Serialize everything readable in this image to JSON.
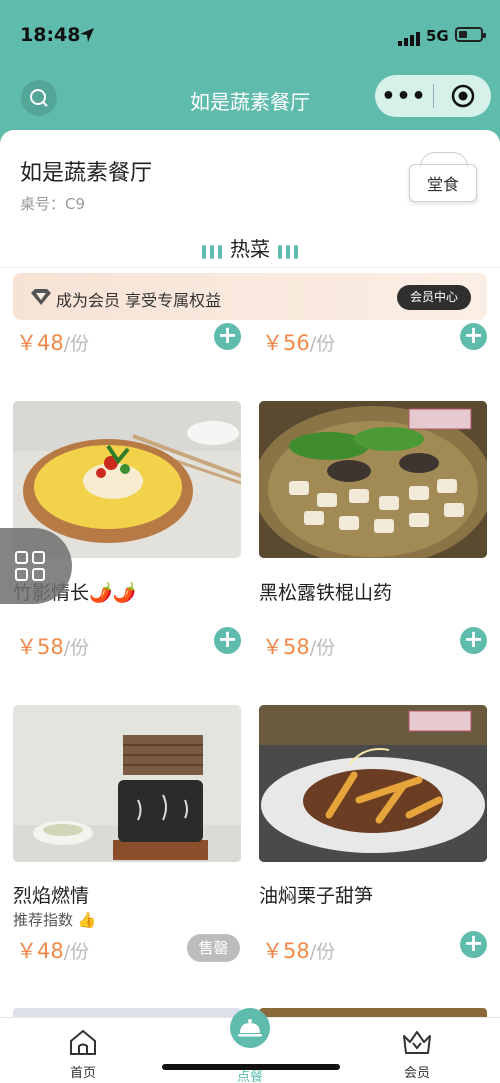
{
  "status": {
    "time": "18:48",
    "network": "5G"
  },
  "nav": {
    "title": "如是蔬素餐厅"
  },
  "header": {
    "restaurant_name": "如是蔬素餐厅",
    "table_no": "桌号：C9",
    "dine_mode": "堂食"
  },
  "category": {
    "title": "热菜"
  },
  "member": {
    "text": "成为会员 享受专属权益",
    "button": "会员中心"
  },
  "partial_row": {
    "left_price": "￥48",
    "right_price": "￥56",
    "unit": "/份"
  },
  "dishes": [
    {
      "name": "竹影情长🌶️🌶️",
      "price": "￥58",
      "unit": "/份",
      "action": "add"
    },
    {
      "name": "黑松露铁棍山药",
      "price": "￥58",
      "unit": "/份",
      "action": "add"
    },
    {
      "name": "烈焰燃情",
      "recommend": "推荐指数",
      "price": "￥48",
      "unit": "/份",
      "action": "sold_out",
      "sold_out_label": "售罄"
    },
    {
      "name": "油焖栗子甜笋",
      "price": "￥58",
      "unit": "/份",
      "action": "add"
    }
  ],
  "tabbar": {
    "home": "首页",
    "order": "点餐",
    "member": "会员"
  },
  "colors": {
    "accent": "#5fbcad",
    "price": "#f08a4b"
  }
}
